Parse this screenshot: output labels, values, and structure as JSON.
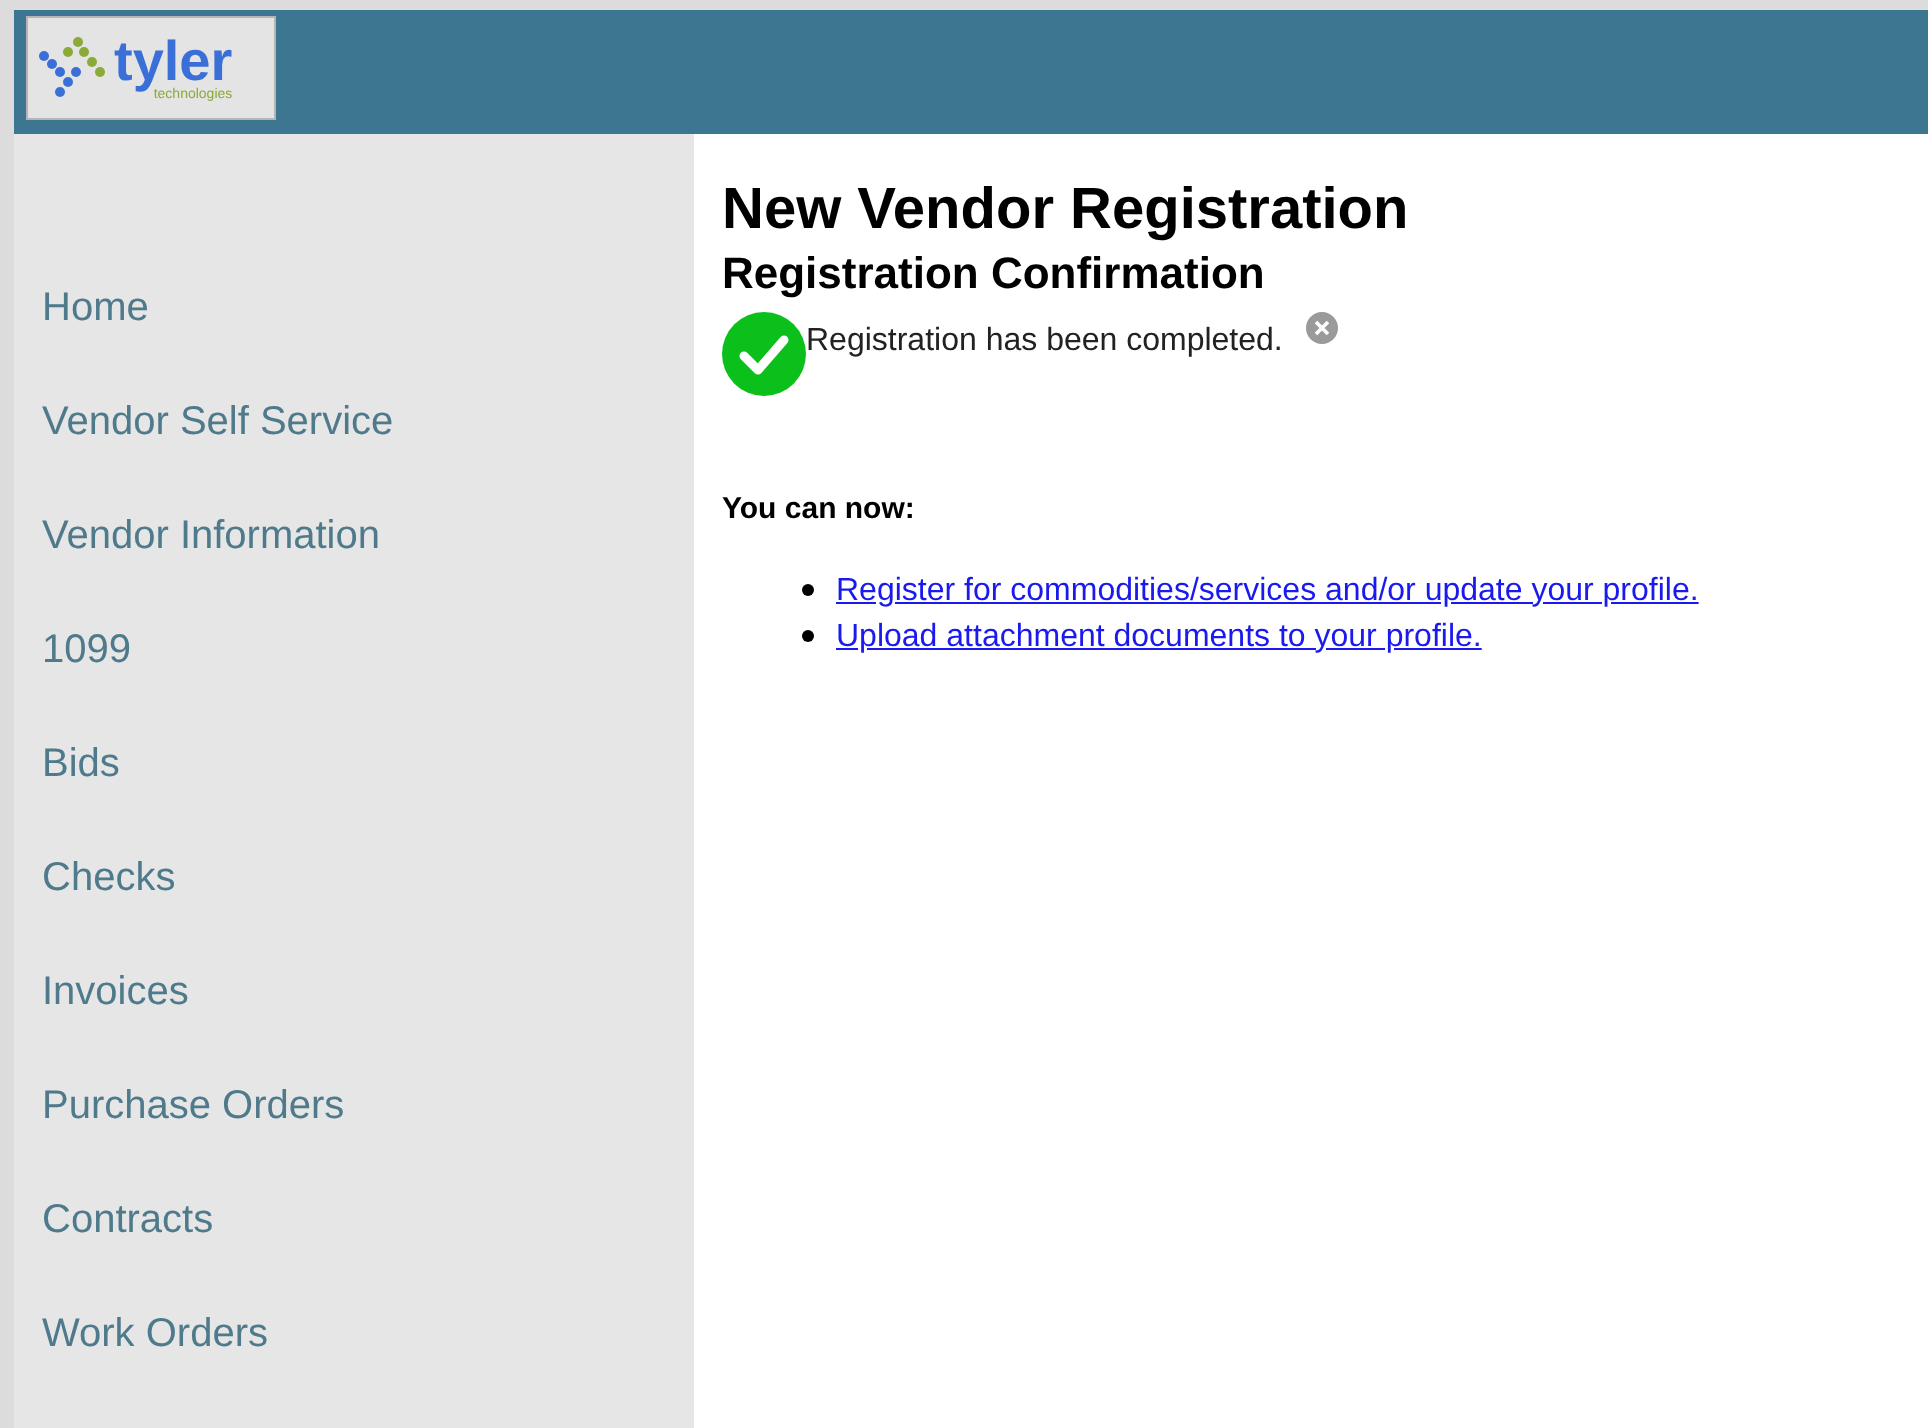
{
  "logo": {
    "name": "tyler",
    "tagline": "technologies"
  },
  "sidebar": {
    "items": [
      {
        "label": "Home"
      },
      {
        "label": "Vendor Self Service"
      },
      {
        "label": "Vendor Information"
      },
      {
        "label": "1099"
      },
      {
        "label": "Bids"
      },
      {
        "label": "Checks"
      },
      {
        "label": "Invoices"
      },
      {
        "label": "Purchase Orders"
      },
      {
        "label": "Contracts"
      },
      {
        "label": "Work Orders"
      }
    ]
  },
  "page": {
    "title": "New Vendor Registration",
    "subtitle": "Registration Confirmation",
    "message": "Registration has been completed.",
    "next_heading": "You can now:",
    "links": [
      "Register for commodities/services and/or update your profile.",
      "Upload attachment documents to your profile."
    ]
  }
}
